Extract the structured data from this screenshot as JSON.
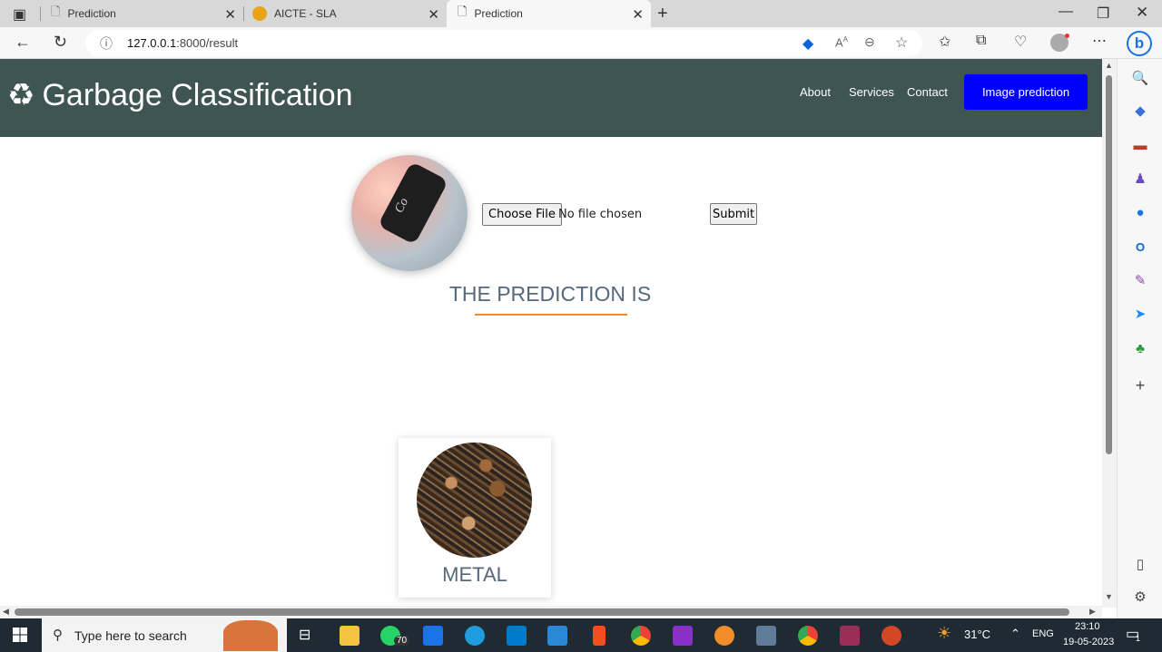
{
  "browser": {
    "tabs": [
      {
        "label": "Prediction",
        "active": false
      },
      {
        "label": "AICTE - SLA",
        "active": false
      },
      {
        "label": "Prediction",
        "active": true
      }
    ],
    "url_host": "127.0.0.1",
    "url_path": ":8000/result"
  },
  "navbar": {
    "brand": "Garbage Classification",
    "links": [
      "About",
      "Services",
      "Contact"
    ],
    "cta": "Image prediction"
  },
  "upload": {
    "choose_label": "Choose File",
    "status": "No file chosen",
    "submit_label": "Submit",
    "preview_text": "Co"
  },
  "result": {
    "heading": "THE PREDICTION IS",
    "label": "METAL"
  },
  "taskbar": {
    "search_placeholder": "Type here to search",
    "whatsapp_badge": "70",
    "temperature": "31°C",
    "language": "ENG",
    "time": "23:10",
    "date": "19-05-2023",
    "notification_count": "1"
  },
  "colors": {
    "navbar_bg": "#3e5551",
    "cta_bg": "#0000ff",
    "heading_color": "#56687a",
    "underline": "#f28c28"
  }
}
